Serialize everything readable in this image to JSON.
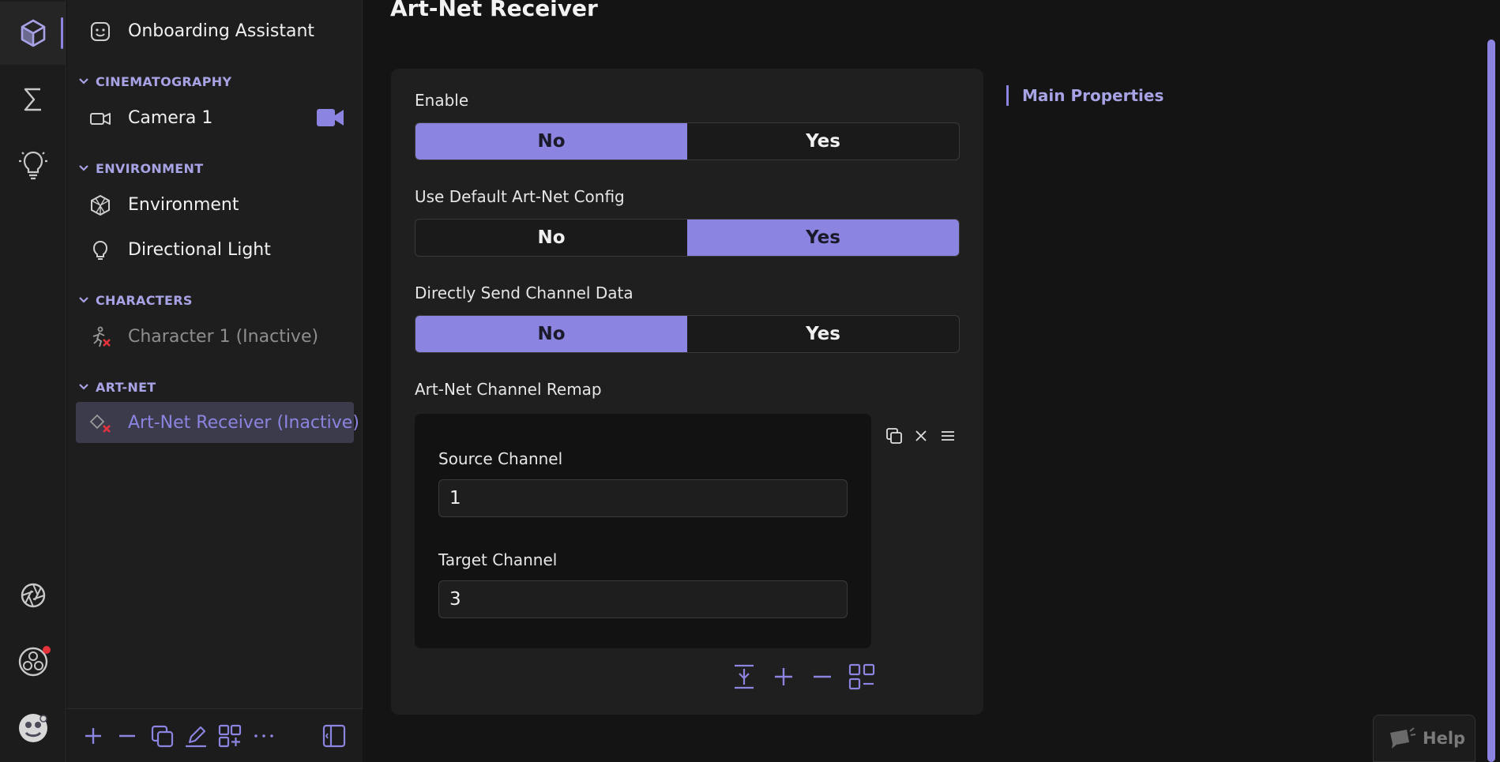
{
  "theme": {
    "accent": "#8b84e0",
    "bg": "#141414",
    "panel": "#1e1e1e",
    "danger": "#e5323b"
  },
  "rail": {
    "items": [
      {
        "icon": "cube-icon",
        "active": true
      },
      {
        "icon": "sigma-icon",
        "active": false
      },
      {
        "icon": "lightbulb-icon",
        "active": false
      },
      {
        "icon": "aperture-icon",
        "active": false
      },
      {
        "icon": "obs-icon",
        "active": false,
        "notification": true
      },
      {
        "icon": "avatar-icon",
        "active": false
      }
    ]
  },
  "scene": {
    "onboarding": {
      "label": "Onboarding Assistant",
      "icon": "smiley-icon"
    },
    "groups": [
      {
        "header": "CINEMATOGRAPHY",
        "items": [
          {
            "label": "Camera 1",
            "icon": "camera-icon",
            "badge": "video-camera-icon"
          }
        ]
      },
      {
        "header": "ENVIRONMENT",
        "items": [
          {
            "label": "Environment",
            "icon": "environment-icon"
          },
          {
            "label": "Directional Light",
            "icon": "lightbulb-icon"
          }
        ]
      },
      {
        "header": "CHARACTERS",
        "items": [
          {
            "label": "Character 1 (Inactive)",
            "icon": "character-inactive-icon",
            "inactive": true
          }
        ]
      },
      {
        "header": "ART-NET",
        "items": [
          {
            "label": "Art-Net Receiver (Inactive)",
            "icon": "artnet-inactive-icon",
            "inactive": true,
            "selected": true
          }
        ]
      }
    ],
    "toolbar": [
      "plus-icon",
      "minus-icon",
      "duplicate-icon",
      "edit-icon",
      "add-grid-icon",
      "more-icon",
      "sidebar-toggle-icon"
    ]
  },
  "main": {
    "title": "Art-Net Receiver",
    "fields": [
      {
        "label": "Enable",
        "options": [
          "No",
          "Yes"
        ],
        "selected": "No"
      },
      {
        "label": "Use Default Art-Net Config",
        "options": [
          "No",
          "Yes"
        ],
        "selected": "Yes"
      },
      {
        "label": "Directly Send Channel Data",
        "options": [
          "No",
          "Yes"
        ],
        "selected": "No"
      }
    ],
    "remap": {
      "label": "Art-Net Channel Remap",
      "source_label": "Source Channel",
      "source_value": "1",
      "target_label": "Target Channel",
      "target_value": "3"
    }
  },
  "toc": {
    "items": [
      "Main Properties"
    ]
  },
  "help": {
    "label": "Help"
  }
}
